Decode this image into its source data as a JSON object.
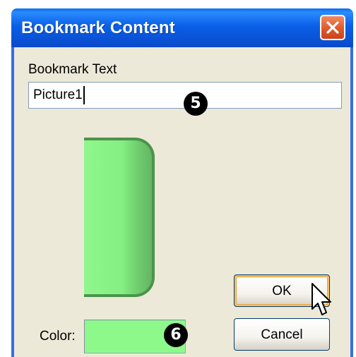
{
  "dialog": {
    "title": "Bookmark Content",
    "bookmark_text_label": "Bookmark Text",
    "bookmark_text_value": "Picture1",
    "color_label": "Color:",
    "selected_color": "#8df98a",
    "ok_label": "OK",
    "cancel_label": "Cancel"
  },
  "callouts": {
    "step_5": "5",
    "step_6": "6"
  },
  "icons": {
    "close": "close-icon",
    "cursor": "mouse-cursor-icon"
  },
  "colors": {
    "titlebar": "#0a5fe6",
    "client_background": "#ece9d8",
    "close_button": "#e0582b",
    "preview_fill": "#8ff78c"
  }
}
